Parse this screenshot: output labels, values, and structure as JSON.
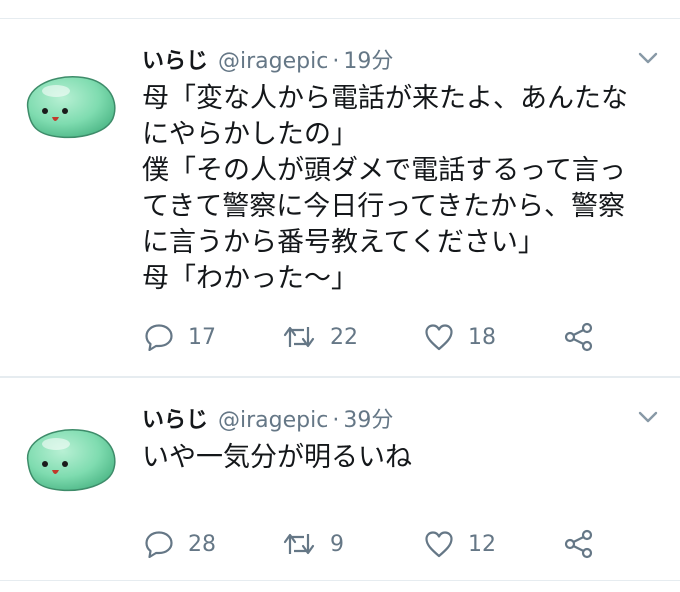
{
  "tweets": [
    {
      "name": "いらじ",
      "handle": "@iragepic",
      "separator": "·",
      "time": "19分",
      "lines": [
        "母「変な人から電話が来たよ、あんたな",
        "にやらかしたの」",
        "僕「その人が頭ダメで電話するって言っ",
        "てきて警察に今日行ってきたから、警察",
        "に言うから番号教えてください」",
        "母「わかった〜」"
      ],
      "replies": "17",
      "retweets": "22",
      "likes": "18"
    },
    {
      "name": "いらじ",
      "handle": "@iragepic",
      "separator": "·",
      "time": "39分",
      "lines": [
        "いや一気分が明るいね"
      ],
      "replies": "28",
      "retweets": "9",
      "likes": "12"
    }
  ],
  "icons": {
    "avatar": "green-slime-avatar",
    "menu": "chevron-down-icon",
    "reply": "reply-icon",
    "retweet": "retweet-icon",
    "like": "heart-icon",
    "share": "share-icon"
  },
  "colors": {
    "text": "#14171a",
    "muted": "#657786",
    "divider": "#e6ecf0",
    "avatar_green": "#7fdcb0"
  }
}
